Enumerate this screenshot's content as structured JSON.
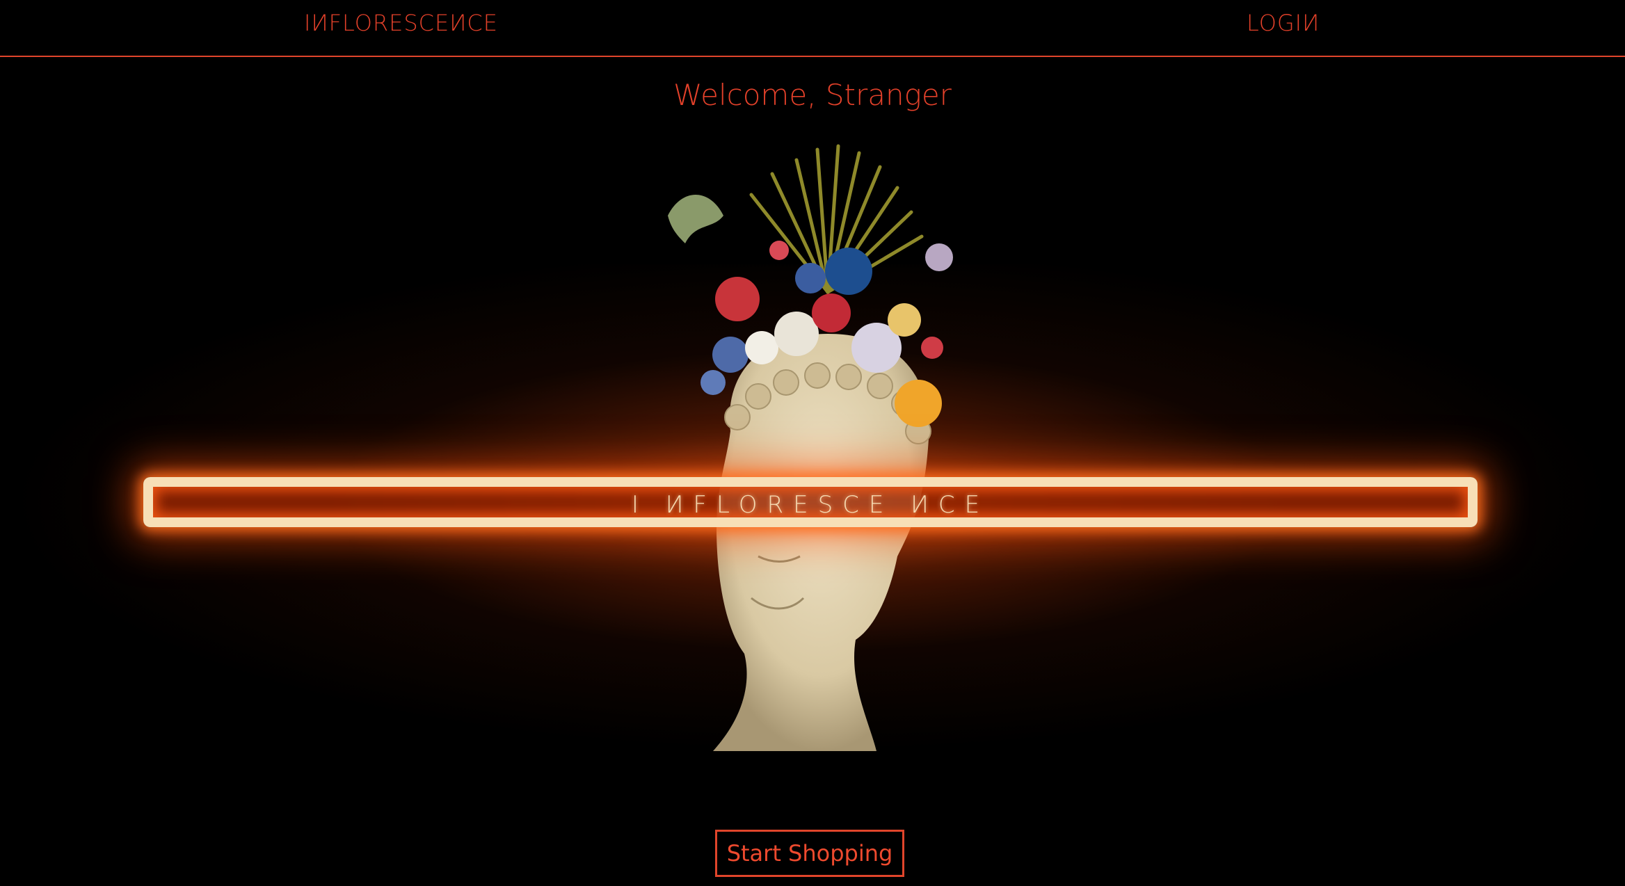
{
  "nav": {
    "brand": "IИFLORESCEИCE",
    "login": "LOGIИ"
  },
  "hero": {
    "welcome": "Welcome, Stranger",
    "neon_sign": "I ИFLORESCE ИCE",
    "image_icon": "flower-crown-statue-icon"
  },
  "cta": {
    "label": "Start Shopping"
  },
  "colors": {
    "accent": "#e4412a",
    "neon_frame": "#f7dfb7",
    "neon_glow": "#ff5a14",
    "background": "#000000"
  }
}
